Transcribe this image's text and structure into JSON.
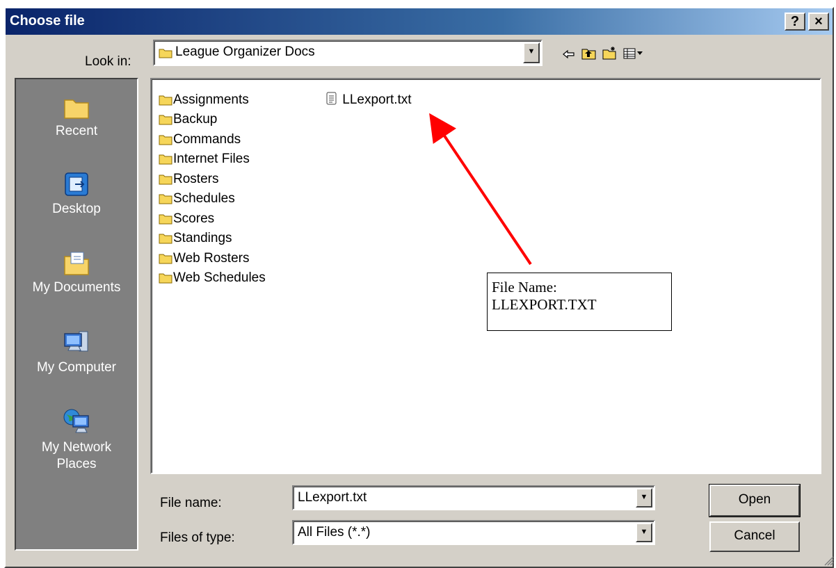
{
  "window": {
    "title": "Choose file",
    "help_label": "?",
    "close_label": "×"
  },
  "lookin": {
    "label": "Look in:",
    "value": "League Organizer Docs",
    "dropdown_glyph": "▼"
  },
  "toolbar": {
    "back_icon": "back-arrow-icon",
    "up_icon": "up-folder-icon",
    "new_folder_icon": "new-folder-icon",
    "view_menu_icon": "view-menu-icon"
  },
  "places": [
    {
      "label": "Recent",
      "icon": "recent-icon"
    },
    {
      "label": "Desktop",
      "icon": "desktop-icon"
    },
    {
      "label": "My Documents",
      "icon": "my-documents-icon"
    },
    {
      "label": "My Computer",
      "icon": "my-computer-icon"
    },
    {
      "label": "My Network\nPlaces",
      "icon": "network-places-icon"
    }
  ],
  "files": {
    "folders": [
      "Assignments",
      "Backup",
      "Commands",
      "Internet Files",
      "Rosters",
      "Schedules",
      "Scores",
      "Standings",
      "Web Rosters",
      "Web Schedules"
    ],
    "documents": [
      "LLexport.txt"
    ]
  },
  "filename": {
    "label": "File name:",
    "value": "LLexport.txt"
  },
  "filetype": {
    "label": "Files of type:",
    "value": "All Files (*.*)"
  },
  "buttons": {
    "open": "Open",
    "cancel": "Cancel"
  },
  "annotation": {
    "line1": "File Name:",
    "line2": "LLEXPORT.TXT",
    "arrow_color": "#ff0000"
  }
}
